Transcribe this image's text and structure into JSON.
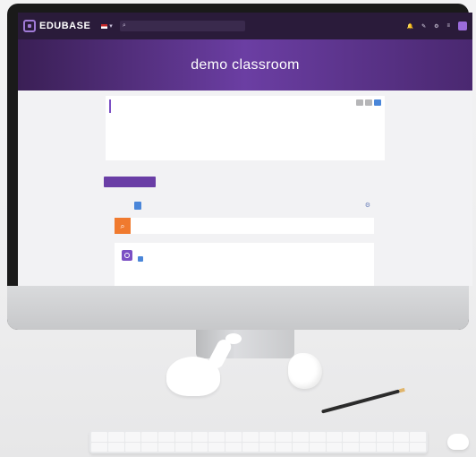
{
  "app": {
    "logo_text": "EDUBASE"
  },
  "hero": {
    "title": "demo classroom"
  },
  "colors": {
    "brand_purple": "#6a3ea6",
    "topbar": "#2a1b3a",
    "accent_blue": "#4a86d9",
    "accent_orange": "#f07a2e"
  },
  "icons": {
    "logo": "edubase-logo-icon",
    "search": "search-icon",
    "notifications": "bell-icon",
    "user": "avatar-icon"
  }
}
